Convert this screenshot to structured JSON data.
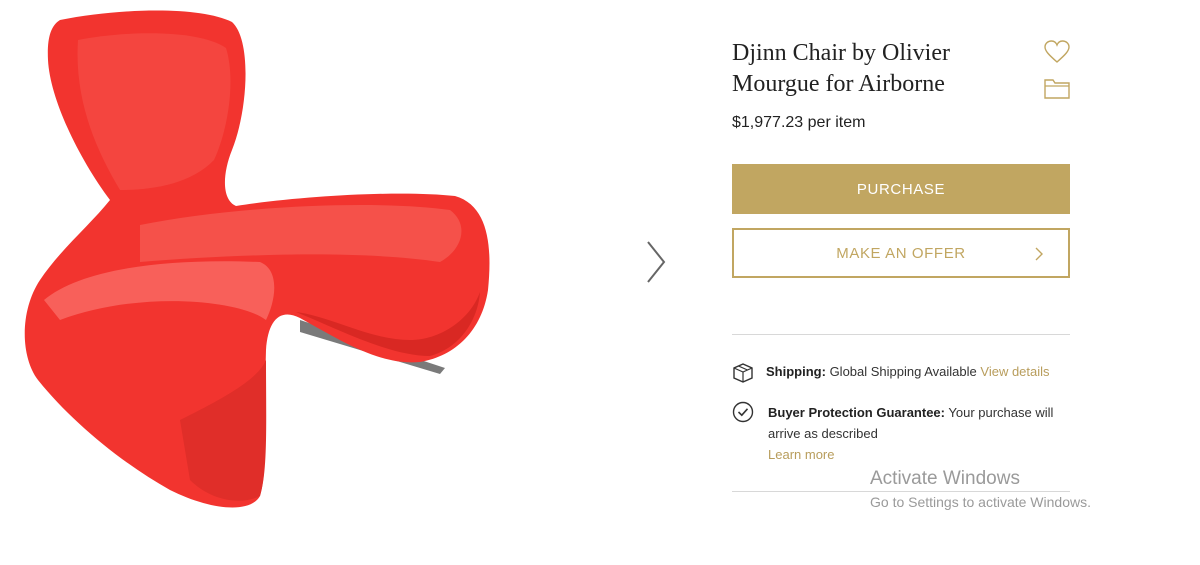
{
  "product": {
    "title": "Djinn Chair by Olivier Mourgue for Airborne",
    "price": "$1,977.23",
    "price_unit": "per item",
    "image_subject": "red-lounge-chair"
  },
  "actions": {
    "purchase_label": "PURCHASE",
    "offer_label": "MAKE AN OFFER"
  },
  "icons": {
    "favorite": "heart-icon",
    "save": "folder-icon",
    "next": "chevron-right-icon",
    "shipping": "box-icon",
    "protection": "check-badge-icon"
  },
  "shipping": {
    "label": "Shipping:",
    "text": "Global Shipping Available",
    "link": "View details"
  },
  "protection": {
    "label": "Buyer Protection Guarantee:",
    "text": "Your purchase will arrive as described",
    "link": "Learn more"
  },
  "watermark": {
    "line1": "Activate Windows",
    "line2": "Go to Settings to activate Windows."
  },
  "colors": {
    "accent": "#c1a661",
    "chair_red": "#f2342f",
    "link": "#b89d5c"
  }
}
